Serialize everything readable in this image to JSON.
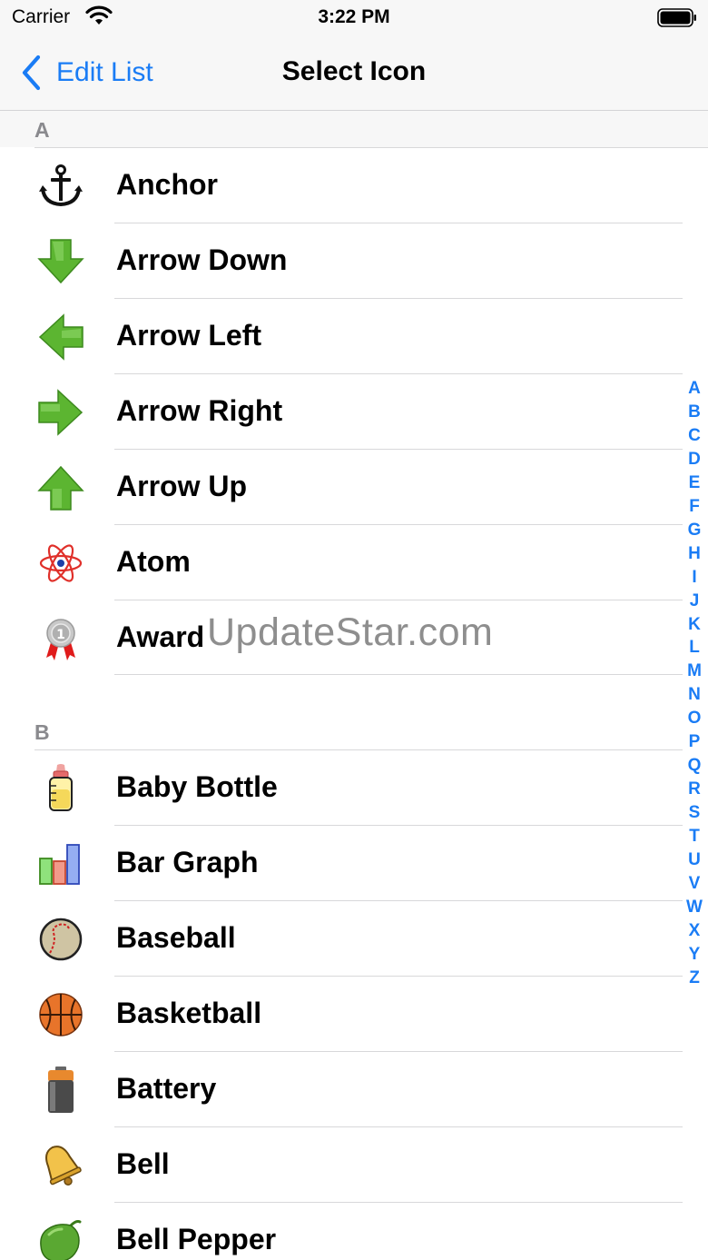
{
  "status_bar": {
    "carrier": "Carrier",
    "time": "3:22 PM"
  },
  "nav": {
    "back_label": "Edit List",
    "title": "Select Icon"
  },
  "sections": [
    {
      "letter": "A",
      "items": [
        {
          "label": "Anchor",
          "icon": "anchor-icon"
        },
        {
          "label": "Arrow Down",
          "icon": "arrow-down-icon"
        },
        {
          "label": "Arrow Left",
          "icon": "arrow-left-icon"
        },
        {
          "label": "Arrow Right",
          "icon": "arrow-right-icon"
        },
        {
          "label": "Arrow Up",
          "icon": "arrow-up-icon"
        },
        {
          "label": "Atom",
          "icon": "atom-icon"
        },
        {
          "label": "Award",
          "icon": "award-icon"
        }
      ]
    },
    {
      "letter": "B",
      "items": [
        {
          "label": "Baby Bottle",
          "icon": "baby-bottle-icon"
        },
        {
          "label": "Bar Graph",
          "icon": "bar-graph-icon"
        },
        {
          "label": "Baseball",
          "icon": "baseball-icon"
        },
        {
          "label": "Basketball",
          "icon": "basketball-icon"
        },
        {
          "label": "Battery",
          "icon": "battery-icon"
        },
        {
          "label": "Bell",
          "icon": "bell-icon"
        },
        {
          "label": "Bell Pepper",
          "icon": "bell-pepper-icon"
        }
      ]
    }
  ],
  "watermark": "UpdateStar.com",
  "section_index": [
    "A",
    "B",
    "C",
    "D",
    "E",
    "F",
    "G",
    "H",
    "I",
    "J",
    "K",
    "L",
    "M",
    "N",
    "O",
    "P",
    "Q",
    "R",
    "S",
    "T",
    "U",
    "V",
    "W",
    "X",
    "Y",
    "Z"
  ],
  "colors": {
    "accent": "#1a7cf5",
    "header_text": "#8a8a8e",
    "arrow_green": "#5cb531"
  }
}
